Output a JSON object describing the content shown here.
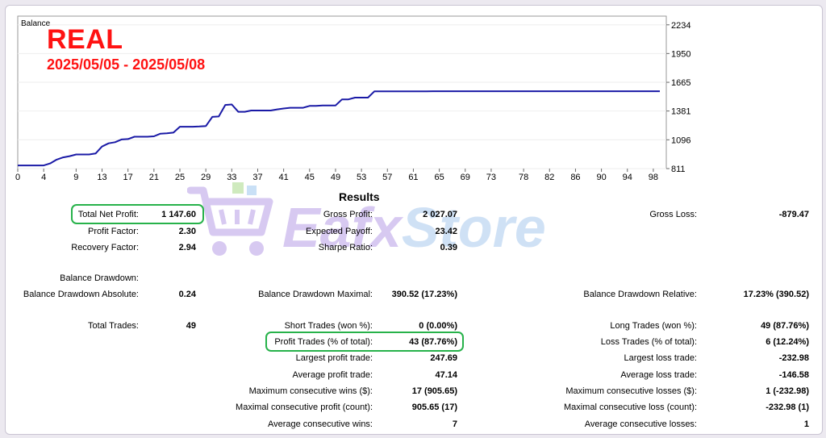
{
  "header": {
    "badge": "REAL",
    "date_range": "2025/05/05 - 2025/05/08"
  },
  "watermark": {
    "text_part1": "Eafx",
    "text_part2": "Store",
    "icon": "shopping-cart-icon"
  },
  "colors": {
    "line": "#1a1aa6",
    "badge": "#ff1212",
    "highlight": "#27b24a",
    "grid": "#eeeeee"
  },
  "chart_data": {
    "type": "line",
    "title": "Balance",
    "x_ticks": [
      0,
      4,
      9,
      13,
      17,
      21,
      25,
      29,
      33,
      37,
      41,
      45,
      49,
      53,
      57,
      61,
      65,
      69,
      73,
      78,
      82,
      86,
      90,
      94,
      98
    ],
    "y_ticks": [
      811,
      1096,
      1381,
      1665,
      1950,
      2234
    ],
    "xlim": [
      0,
      100
    ],
    "ylim": [
      811,
      2320
    ],
    "series": [
      {
        "x": [
          0,
          4,
          5,
          6,
          7,
          8,
          9,
          10,
          11,
          12,
          13,
          14,
          15,
          16,
          17,
          18,
          19,
          20,
          21,
          22,
          23,
          24,
          25,
          26,
          27,
          28,
          29,
          30,
          31,
          32,
          33,
          34,
          35,
          36,
          37,
          38,
          39,
          40,
          41,
          42,
          43,
          44,
          45,
          46,
          47,
          48,
          49,
          50,
          51,
          52,
          53,
          54,
          55,
          56,
          57,
          58,
          59,
          60,
          61,
          62,
          63,
          64,
          65,
          66,
          67,
          68,
          69,
          70,
          71,
          72,
          73,
          74,
          75,
          76,
          77,
          78,
          79,
          80,
          81,
          82,
          83,
          84,
          85,
          86,
          87,
          88,
          89,
          90,
          91,
          92,
          93,
          94,
          95,
          96,
          97,
          98,
          99
        ],
        "y": [
          842,
          842,
          862,
          900,
          922,
          934,
          951,
          951,
          951,
          960,
          1030,
          1061,
          1072,
          1099,
          1103,
          1126,
          1126,
          1126,
          1130,
          1157,
          1160,
          1167,
          1225,
          1225,
          1225,
          1228,
          1232,
          1323,
          1327,
          1441,
          1446,
          1373,
          1373,
          1386,
          1386,
          1386,
          1386,
          1397,
          1406,
          1413,
          1413,
          1413,
          1431,
          1431,
          1436,
          1436,
          1436,
          1496,
          1496,
          1514,
          1514,
          1514,
          1576,
          1576,
          1576,
          1576,
          1576,
          1576,
          1576,
          1576,
          1576,
          1577,
          1577,
          1577,
          1577,
          1577,
          1577,
          1577,
          1577,
          1577,
          1577,
          1577,
          1577,
          1577,
          1577,
          1577,
          1577,
          1577,
          1577,
          1577,
          1577,
          1577,
          1577,
          1577,
          1577,
          1577,
          1577,
          1577,
          1577,
          1577,
          1577,
          1577,
          1577,
          1577,
          1577,
          1577,
          1577
        ]
      }
    ]
  },
  "results": {
    "title": "Results",
    "total_net_profit": {
      "label": "Total Net Profit:",
      "value": "1 147.60"
    },
    "gross_profit": {
      "label": "Gross Profit:",
      "value": "2 027.07"
    },
    "gross_loss": {
      "label": "Gross Loss:",
      "value": "-879.47"
    },
    "profit_factor": {
      "label": "Profit Factor:",
      "value": "2.30"
    },
    "expected_payoff": {
      "label": "Expected Payoff:",
      "value": "23.42"
    },
    "recovery_factor": {
      "label": "Recovery Factor:",
      "value": "2.94"
    },
    "sharpe_ratio": {
      "label": "Sharpe Ratio:",
      "value": "0.39"
    },
    "balance_drawdown": {
      "label": "Balance Drawdown:"
    },
    "bd_absolute": {
      "label": "Balance Drawdown Absolute:",
      "value": "0.24"
    },
    "bd_maximal": {
      "label": "Balance Drawdown Maximal:",
      "value": "390.52 (17.23%)"
    },
    "bd_relative": {
      "label": "Balance Drawdown Relative:",
      "value": "17.23% (390.52)"
    },
    "total_trades": {
      "label": "Total Trades:",
      "value": "49"
    },
    "short_trades": {
      "label": "Short Trades (won %):",
      "value": "0 (0.00%)"
    },
    "long_trades": {
      "label": "Long Trades (won %):",
      "value": "49 (87.76%)"
    },
    "profit_trades": {
      "label": "Profit Trades (% of total):",
      "value": "43 (87.76%)"
    },
    "loss_trades": {
      "label": "Loss Trades (% of total):",
      "value": "6 (12.24%)"
    },
    "largest_profit": {
      "label": "Largest profit trade:",
      "value": "247.69"
    },
    "largest_loss": {
      "label": "Largest loss trade:",
      "value": "-232.98"
    },
    "avg_profit": {
      "label": "Average profit trade:",
      "value": "47.14"
    },
    "avg_loss": {
      "label": "Average loss trade:",
      "value": "-146.58"
    },
    "max_consec_wins": {
      "label": "Maximum consecutive wins ($):",
      "value": "17 (905.65)"
    },
    "max_consec_losses": {
      "label": "Maximum consecutive losses ($):",
      "value": "1 (-232.98)"
    },
    "maximal_consec_profit": {
      "label": "Maximal consecutive profit (count):",
      "value": "905.65 (17)"
    },
    "maximal_consec_loss": {
      "label": "Maximal consecutive loss (count):",
      "value": "-232.98 (1)"
    },
    "avg_consec_wins": {
      "label": "Average consecutive wins:",
      "value": "7"
    },
    "avg_consec_losses": {
      "label": "Average consecutive losses:",
      "value": "1"
    }
  }
}
